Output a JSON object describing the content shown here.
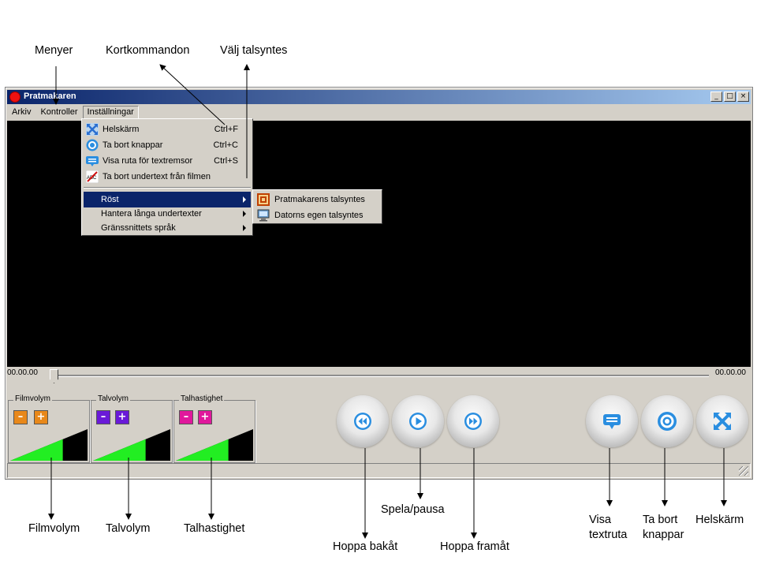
{
  "annotations": {
    "menyer": "Menyer",
    "kortkommandon": "Kortkommandon",
    "valj_talsyntes": "Välj talsyntes",
    "filmvolym": "Filmvolym",
    "talvolym": "Talvolym",
    "talhastighet": "Talhastighet",
    "hoppa_bakat": "Hoppa bakåt",
    "spela_pausa": "Spela/pausa",
    "hoppa_framat": "Hoppa framåt",
    "visa_textruta": [
      "Visa",
      "textruta"
    ],
    "ta_bort_knappar": [
      "Ta bort",
      "knappar"
    ],
    "helskarm": "Helskärm"
  },
  "window": {
    "title": "Pratmakaren",
    "controls": [
      "_",
      "□",
      "×"
    ]
  },
  "menubar": [
    "Arkiv",
    "Kontroller",
    "Inställningar"
  ],
  "dropdown": {
    "items": [
      {
        "label": "Helskärm",
        "shortcut": "Ctrl+F",
        "icon": "fullscreen-icon"
      },
      {
        "label": "Ta bort knappar",
        "shortcut": "Ctrl+C",
        "icon": "remove-buttons-icon"
      },
      {
        "label": "Visa ruta för textremsor",
        "shortcut": "Ctrl+S",
        "icon": "subtitle-box-icon"
      },
      {
        "label": "Ta bort undertext från filmen",
        "shortcut": "",
        "icon": "abc-strike-icon"
      }
    ],
    "submenus": [
      "Röst",
      "Hantera långa undertexter",
      "Gränssnittets språk"
    ]
  },
  "voice_submenu": [
    "Pratmakarens talsyntes",
    "Datorns egen talsyntes"
  ],
  "player": {
    "time_start": "00.00.00",
    "time_end": "00.00.00",
    "position": 0
  },
  "controls": {
    "groups": [
      {
        "label": "Filmvolym",
        "color": "#e8881a",
        "level": 0.68
      },
      {
        "label": "Talvolym",
        "color": "#6a1ad8",
        "level": 0.68
      },
      {
        "label": "Talhastighet",
        "color": "#e0189c",
        "level": 0.68
      }
    ],
    "minus": "–",
    "plus": "+",
    "level_color": "#22ee22"
  },
  "colors": {
    "titlebar_start": "#0a246a",
    "titlebar_end": "#a6caf0",
    "button_icon_blue": "#2a8ee0"
  }
}
